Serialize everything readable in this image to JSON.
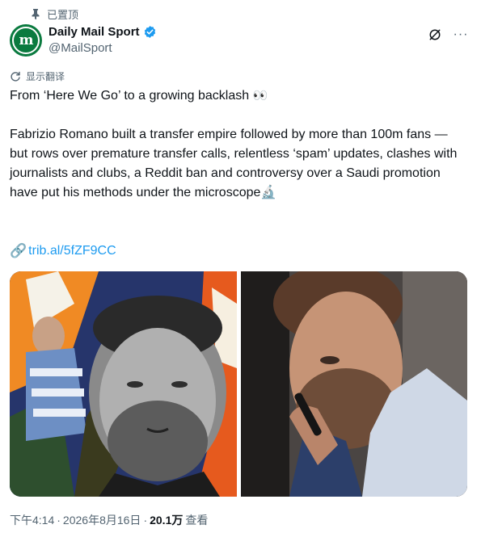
{
  "pinned": {
    "label": "已置顶"
  },
  "author": {
    "display_name": "Daily Mail Sport",
    "handle": "@MailSport",
    "avatar_letters": "m",
    "verified_color": "#1d9bf0",
    "avatar_color": "#0a7a3f"
  },
  "actions": {
    "more_label": "···"
  },
  "translate": {
    "label": "显示翻译"
  },
  "tweet": {
    "headline": "From ‘Here We Go’ to a growing backlash",
    "headline_emoji": "👀",
    "body": "Fabrizio Romano built a transfer empire followed by more than 100m fans — but rows over premature transfer calls, relentless ‘spam’ updates, clashes with journalists and clubs, a Reddit ban and controversy over a Saudi promotion have put his methods under the microscope",
    "body_emoji": "🔬",
    "link_icon": "🔗",
    "link_text": "trib.al/5fZF9CC"
  },
  "media": [
    {
      "name": "romano-collage-photo"
    },
    {
      "name": "romano-phone-photo"
    }
  ],
  "meta": {
    "time": "下午4:14",
    "separator": "·",
    "date": "2026年8月16日",
    "views_count": "20.1万",
    "views_label": "查看"
  },
  "colors": {
    "link": "#1d9bf0",
    "secondary_text": "#536471",
    "primary_text": "#0f1419"
  }
}
